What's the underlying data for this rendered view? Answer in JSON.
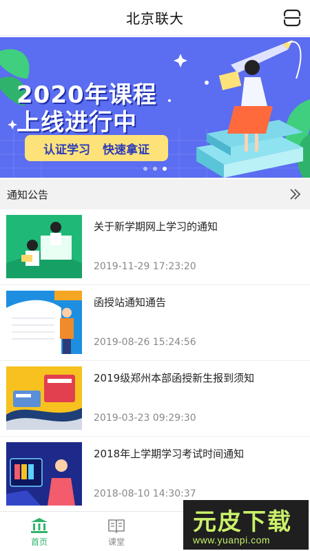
{
  "header": {
    "title": "北京联大",
    "scan_icon": "scan-icon"
  },
  "banner": {
    "headline_line1": "2020年课程",
    "headline_line2": "上线进行中",
    "tag_left": "认证学习",
    "tag_right": "快速拿证",
    "slide_count": 3,
    "active_slide": 3
  },
  "notice": {
    "section_label": "通知公告",
    "more_icon": "double-chevron-right-icon",
    "items": [
      {
        "title": "关于新学期网上学习的通知",
        "date": "2019-11-29 17:23:20",
        "thumb": "green-reading-illustration"
      },
      {
        "title": "函授站通知通告",
        "date": "2019-08-26 15:24:56",
        "thumb": "blue-book-illustration"
      },
      {
        "title": "2019级郑州本部函授新生报到须知",
        "date": "2019-03-23 09:29:30",
        "thumb": "yellow-books-illustration"
      },
      {
        "title": "2018年上学期学习考试时间通知",
        "date": "2018-08-10 14:30:37",
        "thumb": "navy-screen-illustration"
      }
    ]
  },
  "tabbar": {
    "tabs": [
      {
        "label": "首页",
        "icon": "bank-icon",
        "active": true
      },
      {
        "label": "课堂",
        "icon": "book-open-icon",
        "active": false
      }
    ]
  },
  "watermark": {
    "text": "元皮下载",
    "url": "www.yuanpi.com"
  },
  "colors": {
    "accent": "#2fb36b",
    "banner_bg": "#5b6df0",
    "banner_pill": "#fde27a"
  }
}
